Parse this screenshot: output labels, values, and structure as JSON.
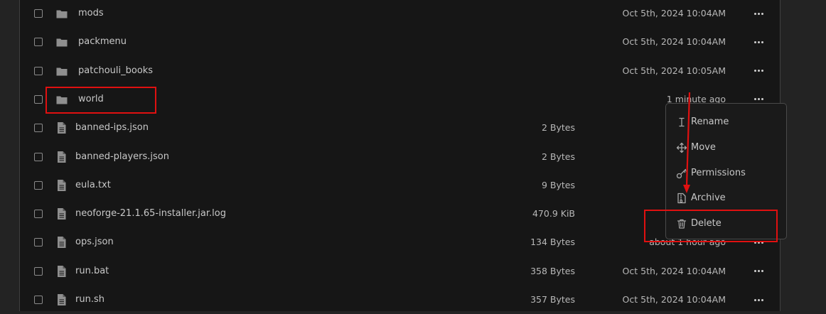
{
  "files": [
    {
      "name": "mods",
      "type": "folder",
      "size": "",
      "modified": "Oct 5th, 2024 10:04AM"
    },
    {
      "name": "packmenu",
      "type": "folder",
      "size": "",
      "modified": "Oct 5th, 2024 10:04AM"
    },
    {
      "name": "patchouli_books",
      "type": "folder",
      "size": "",
      "modified": "Oct 5th, 2024 10:05AM"
    },
    {
      "name": "world",
      "type": "folder",
      "size": "",
      "modified": "1 minute ago"
    },
    {
      "name": "banned-ips.json",
      "type": "file",
      "size": "2 Bytes",
      "modified": ""
    },
    {
      "name": "banned-players.json",
      "type": "file",
      "size": "2 Bytes",
      "modified": ""
    },
    {
      "name": "eula.txt",
      "type": "file",
      "size": "9 Bytes",
      "modified": "Oct"
    },
    {
      "name": "neoforge-21.1.65-installer.jar.log",
      "type": "file",
      "size": "470.9 KiB",
      "modified": "Oct"
    },
    {
      "name": "ops.json",
      "type": "file",
      "size": "134 Bytes",
      "modified": "about 1 hour ago"
    },
    {
      "name": "run.bat",
      "type": "file",
      "size": "358 Bytes",
      "modified": "Oct 5th, 2024 10:04AM"
    },
    {
      "name": "run.sh",
      "type": "file",
      "size": "357 Bytes",
      "modified": "Oct 5th, 2024 10:04AM"
    }
  ],
  "context_menu": {
    "items": [
      {
        "label": "Rename",
        "icon": "text-cursor-icon"
      },
      {
        "label": "Move",
        "icon": "move-arrows-icon"
      },
      {
        "label": "Permissions",
        "icon": "key-icon"
      },
      {
        "label": "Archive",
        "icon": "archive-file-icon"
      },
      {
        "label": "Delete",
        "icon": "trash-icon"
      }
    ]
  },
  "colors": {
    "background": "#232323",
    "panel": "#161616",
    "text": "#c8c8c8",
    "muted_text": "#b8b8b8",
    "icon": "#8f8f8f",
    "annotation": "#e01010"
  }
}
